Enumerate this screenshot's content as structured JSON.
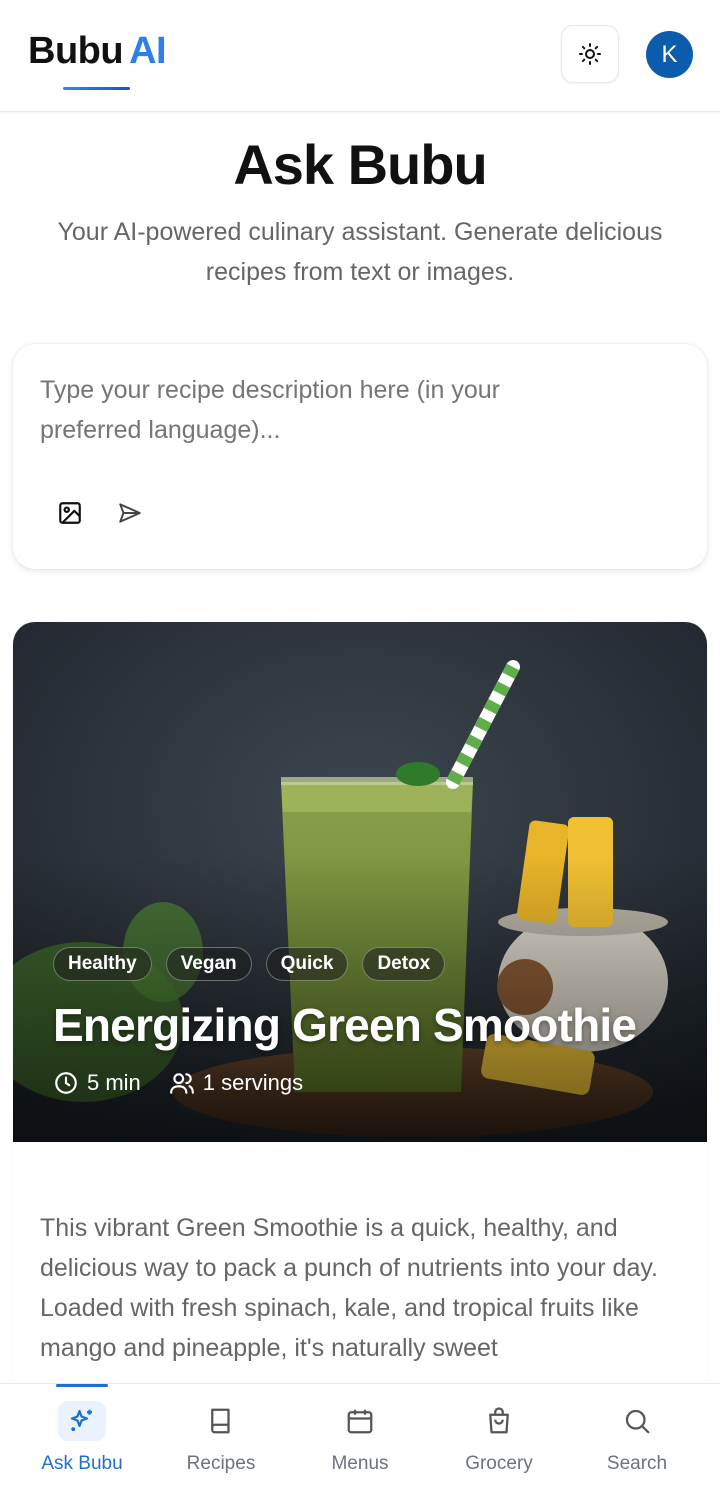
{
  "app": {
    "logo_main": "Bubu",
    "logo_accent": "AI",
    "avatar_initial": "K",
    "accent_color": "#2f7fe6"
  },
  "hero": {
    "title": "Ask Bubu",
    "subtitle": "Your AI-powered culinary assistant. Generate delicious recipes from text or images."
  },
  "prompt": {
    "placeholder": "Type your recipe description here (in your preferred language)...",
    "value": ""
  },
  "recipe": {
    "tags": [
      "Healthy",
      "Vegan",
      "Quick",
      "Detox"
    ],
    "title": "Energizing Green Smoothie",
    "time": "5 min",
    "servings": "1 servings",
    "description": "This vibrant Green Smoothie is a quick, healthy, and delicious way to pack a punch of nutrients into your day. Loaded with fresh spinach, kale, and tropical fruits like mango and pineapple, it's naturally sweet"
  },
  "nav": {
    "items": [
      {
        "label": "Ask Bubu",
        "icon": "sparkles-icon",
        "active": true
      },
      {
        "label": "Recipes",
        "icon": "book-icon",
        "active": false
      },
      {
        "label": "Menus",
        "icon": "calendar-icon",
        "active": false
      },
      {
        "label": "Grocery",
        "icon": "shopping-bag-icon",
        "active": false
      },
      {
        "label": "Search",
        "icon": "search-icon",
        "active": false
      }
    ]
  }
}
